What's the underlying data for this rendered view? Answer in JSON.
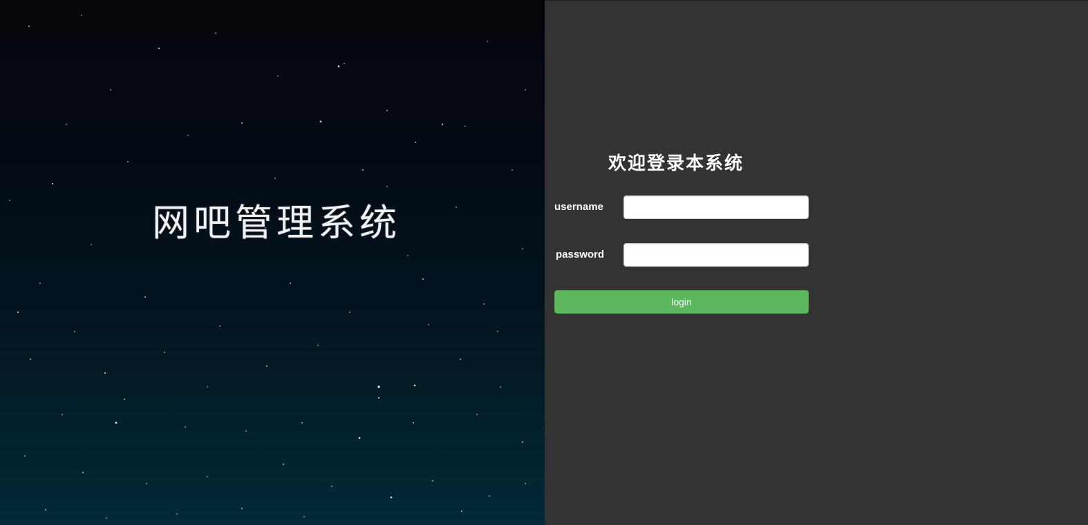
{
  "hero": {
    "title": "网吧管理系统"
  },
  "login": {
    "welcome": "欢迎登录本系统",
    "username_label": "username",
    "username_value": "",
    "password_label": "password",
    "password_value": "",
    "submit_label": "login"
  },
  "colors": {
    "panel_background": "#333333",
    "button_green": "#5cb85c",
    "hero_top": "#05050b",
    "hero_bottom": "#022a38",
    "text_white": "#ffffff"
  }
}
